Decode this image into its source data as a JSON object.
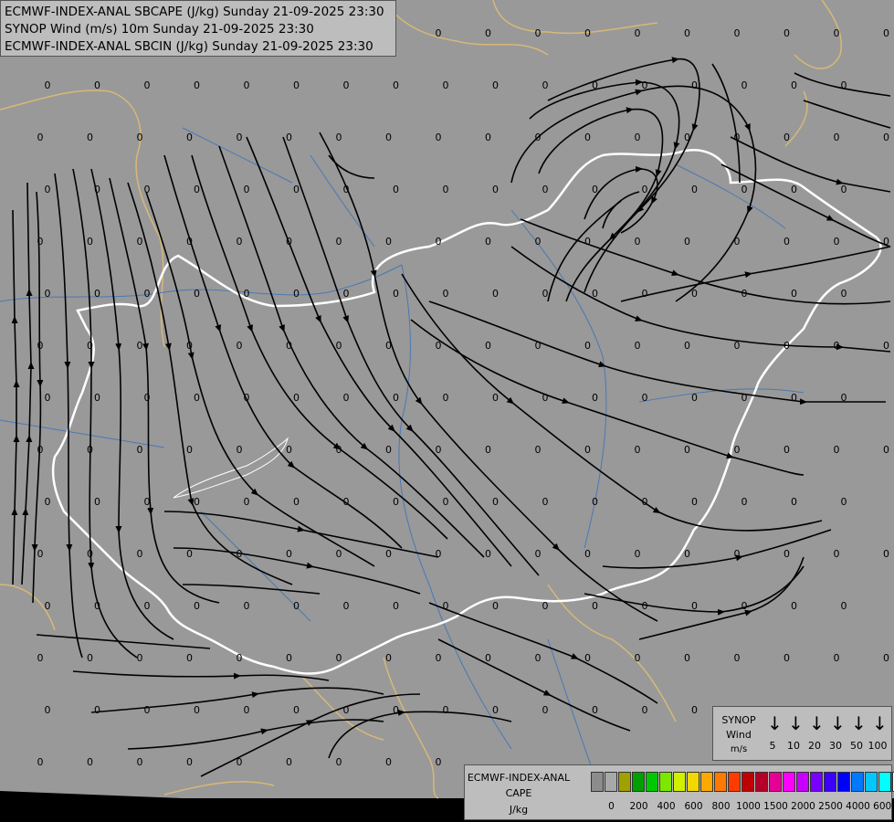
{
  "titles": [
    "ECMWF-INDEX-ANAL SBCAPE (J/kg) Sunday 21-09-2025 23:30",
    "SYNOP Wind (m/s) 10m Sunday 21-09-2025 23:30",
    "ECMWF-INDEX-ANAL SBCIN (J/kg) Sunday 21-09-2025 23:30"
  ],
  "wind_legend": {
    "title": "SYNOP",
    "subtitle": "Wind",
    "unit": "m/s",
    "speeds": [
      "5",
      "10",
      "20",
      "30",
      "50",
      "100"
    ]
  },
  "cape_legend": {
    "title": "ECMWF-INDEX-ANAL",
    "subtitle": "CAPE",
    "unit": "J/kg",
    "colors": [
      "#8c8c8c",
      "#a8a8a8",
      "#a0a000",
      "#00a000",
      "#00c800",
      "#7ce800",
      "#d0f000",
      "#f0d800",
      "#ffa800",
      "#ff7800",
      "#ff3c00",
      "#c00000",
      "#b40028",
      "#e60096",
      "#ff00ff",
      "#c800ff",
      "#7800ff",
      "#3c00ff",
      "#0000ff",
      "#0078ff",
      "#00c8ff",
      "#00ffff",
      "#ffffff"
    ],
    "ticks": [
      "0",
      "200",
      "400",
      "600",
      "800",
      "1000",
      "1500",
      "2000",
      "2500",
      "4000",
      "6000"
    ]
  },
  "field_value": "0",
  "colors": {
    "map_background": "#999999",
    "rivers": "#4a78b4",
    "regional_borders": "#d8b878",
    "national_border": "#ffffff",
    "streamlines": "#000000"
  }
}
